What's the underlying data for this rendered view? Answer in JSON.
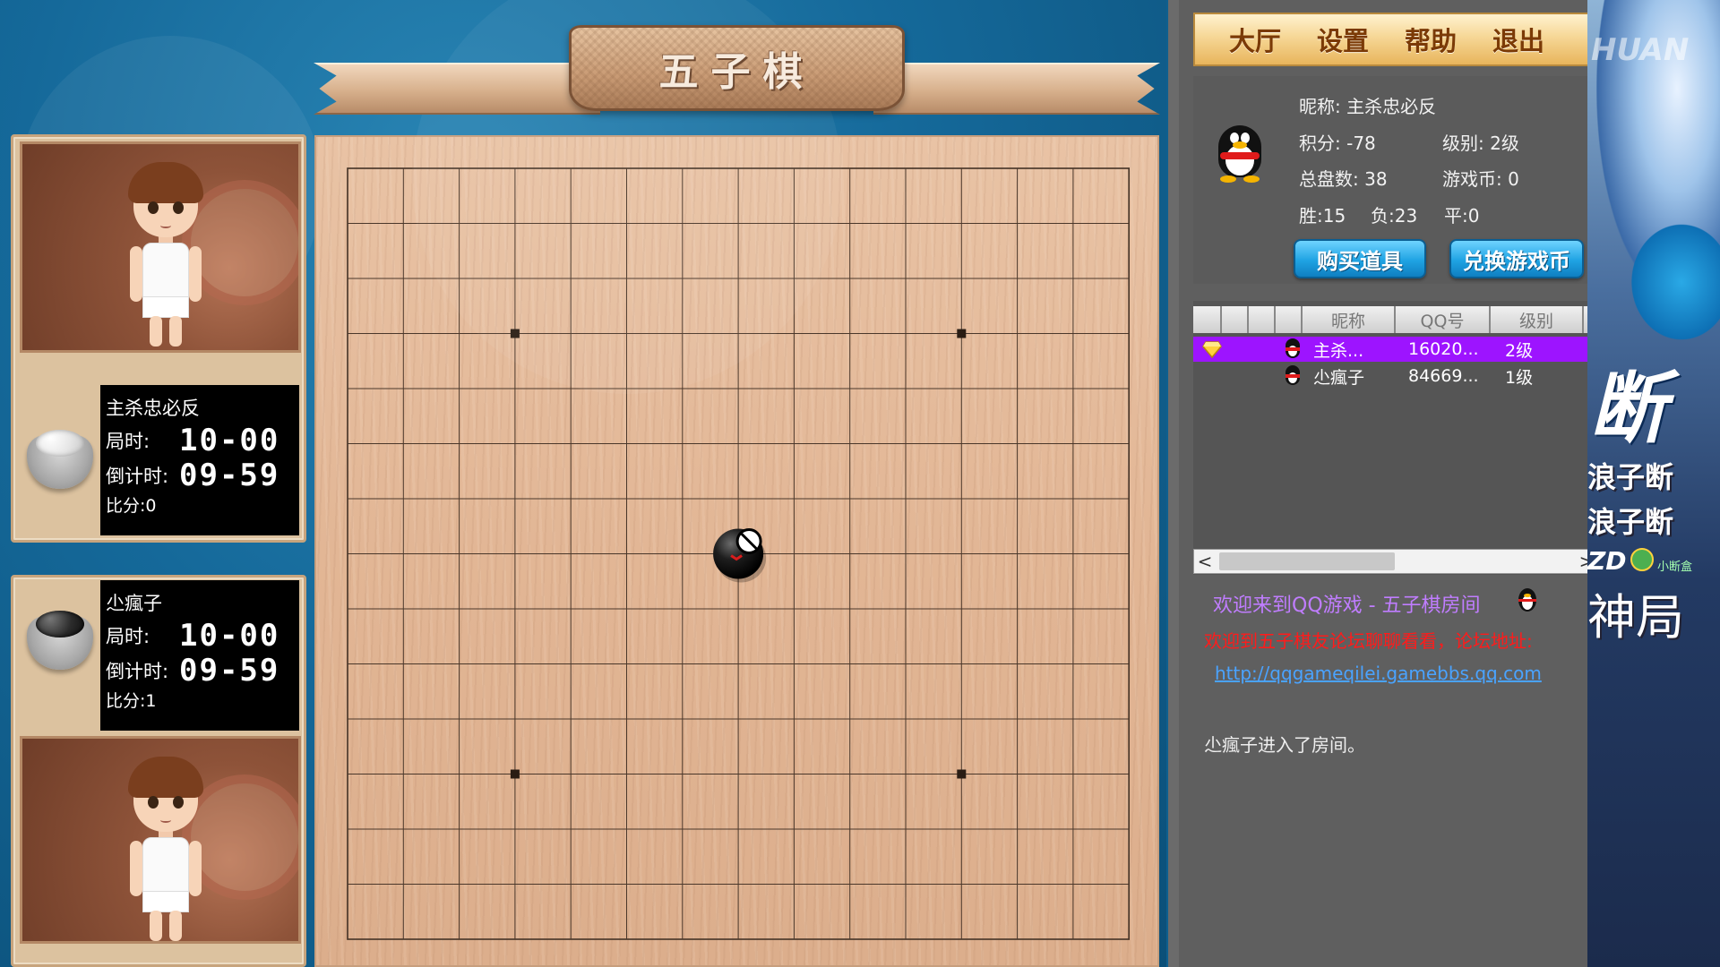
{
  "game": {
    "title": "五子棋",
    "board_size": 15,
    "star_points": [
      [
        3,
        3
      ],
      [
        11,
        3
      ],
      [
        3,
        11
      ],
      [
        11,
        11
      ]
    ],
    "stones": [
      {
        "col": 7,
        "row": 7,
        "color": "black"
      }
    ]
  },
  "players": [
    {
      "name": "主杀忠必反",
      "stone": "white",
      "game_time_label": "局时:",
      "game_time": "10-00",
      "countdown_label": "倒计时:",
      "countdown": "09-59",
      "score_label": "比分:",
      "score": "0"
    },
    {
      "name": "尐瘋子",
      "stone": "black",
      "game_time_label": "局时:",
      "game_time": "10-00",
      "countdown_label": "倒计时:",
      "countdown": "09-59",
      "score_label": "比分:",
      "score": "1"
    }
  ],
  "menu": {
    "items": [
      "大厅",
      "设置",
      "帮助",
      "退出"
    ]
  },
  "profile": {
    "nickname_label": "昵称:",
    "nickname": "主杀忠必反",
    "points_label": "积分:",
    "points": "-78",
    "level_label": "级别:",
    "level": "2级",
    "total_games_label": "总盘数:",
    "total_games": "38",
    "coins_label": "游戏币:",
    "coins": "0",
    "wins_label": "胜:",
    "wins": "15",
    "losses_label": "负:",
    "losses": "23",
    "draws_label": "平:",
    "draws": "0",
    "buy_button": "购买道具",
    "exchange_button": "兑换游戏币"
  },
  "user_list": {
    "headers": [
      "昵称",
      "QQ号",
      "级别"
    ],
    "rows": [
      {
        "name": "主杀...",
        "qq": "16020...",
        "level": "2级",
        "selected": true
      },
      {
        "name": "尐瘋子",
        "qq": "84669...",
        "level": "1级",
        "selected": false
      }
    ],
    "scroll_left": "<",
    "scroll_right": ">"
  },
  "chat": {
    "welcome": "欢迎来到QQ游戏 - 五子棋房间",
    "forum_notice": "欢迎到五子棋友论坛聊聊看看，论坛地址:",
    "forum_link": "http://qqgameqilei.gamebbs.qq.com",
    "system_message": "尐瘋子进入了房间。"
  },
  "overlay": {
    "watermark": "HUAN",
    "big_text": "断",
    "banner1": "浪子断",
    "banner2": "浪子断",
    "tag": "ZD",
    "badge": "小断盒",
    "footer": "神局"
  },
  "colors": {
    "selected_row": "#9d14ff",
    "welcome_text": "#c07dff",
    "forum_notice_text": "#ff1b1b",
    "link_text": "#4aa3ff",
    "menu_text": "#7b3a06"
  }
}
